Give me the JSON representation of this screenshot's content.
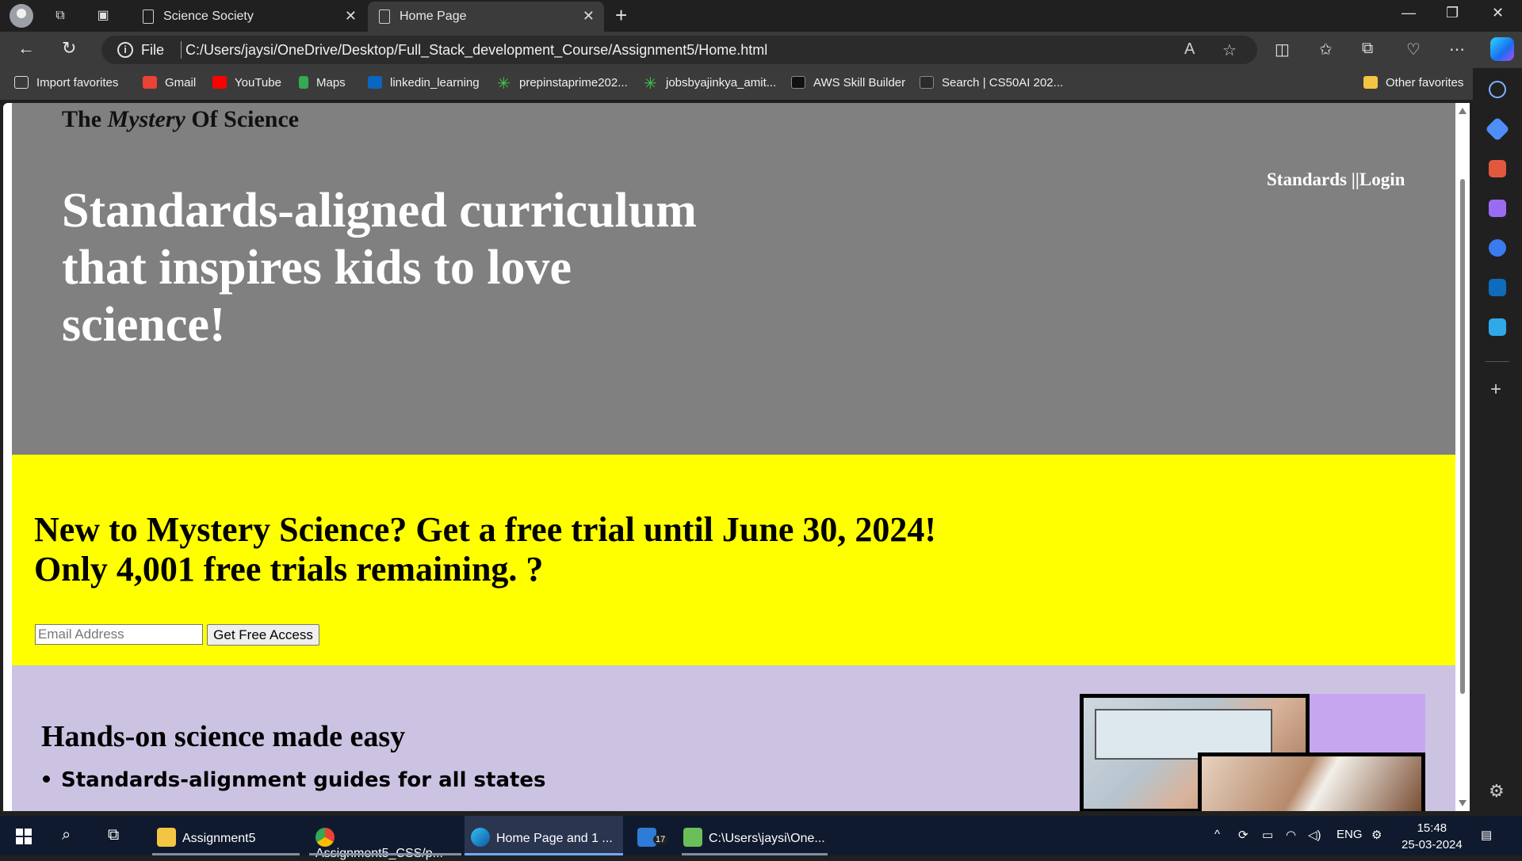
{
  "browser": {
    "tabs": [
      {
        "label": "Science Society"
      },
      {
        "label": "Home Page"
      }
    ],
    "address": {
      "scheme_label": "File",
      "url": "C:/Users/jaysi/OneDrive/Desktop/Full_Stack_development_Course/Assignment5/Home.html"
    },
    "favorites": [
      {
        "label": "Import favorites",
        "icon": "import-icon"
      },
      {
        "label": "Gmail",
        "icon": "gmail-icon"
      },
      {
        "label": "YouTube",
        "icon": "youtube-icon"
      },
      {
        "label": "Maps",
        "icon": "maps-icon"
      },
      {
        "label": "linkedin_learning",
        "icon": "linkedin-icon"
      },
      {
        "label": "prepinstaprime202...",
        "icon": "asterisk-icon"
      },
      {
        "label": "jobsbyajinkya_amit...",
        "icon": "asterisk-icon"
      },
      {
        "label": "AWS Skill Builder",
        "icon": "aws-icon"
      },
      {
        "label": "Search | CS50AI 202...",
        "icon": "edx-icon"
      },
      {
        "label": "Other favorites",
        "icon": "folder-icon"
      }
    ]
  },
  "page": {
    "brand": {
      "prefix": "The",
      "italic": "Mystery",
      "suffix": "Of Science"
    },
    "nav": {
      "standards": "Standards",
      "separator": "||",
      "login": "Login"
    },
    "headline": "Standards-aligned curriculum that inspires kids to love science!",
    "promo": {
      "line1": "New to Mystery Science? Get a free trial until June 30, 2024!",
      "line2": "Only 4,001 free trials remaining. ?",
      "email_placeholder": "Email Address",
      "button_label": "Get Free Access"
    },
    "features": {
      "title": "Hands-on science made easy",
      "items": [
        "Standards-alignment guides for all states"
      ]
    }
  },
  "taskbar": {
    "apps": [
      {
        "label": "Assignment5"
      },
      {
        "label": "Assignment5_CSS/p..."
      },
      {
        "label": "Home Page and 1 ..."
      },
      {
        "label": "17"
      },
      {
        "label": "C:\\Users\\jaysi\\One..."
      }
    ],
    "language": "ENG",
    "time": "15:48",
    "date": "25-03-2024"
  },
  "colors": {
    "hero_bg": "#808080",
    "promo_bg": "#ffff00",
    "features_bg": "#ccc3e3",
    "browser_chrome": "#3b3b3b"
  }
}
